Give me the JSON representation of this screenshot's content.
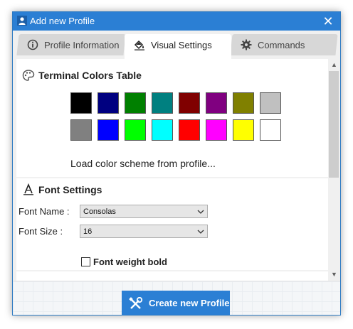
{
  "window": {
    "title": "Add new Profile",
    "close_glyph": "✕"
  },
  "tabs": [
    {
      "label": "Profile Information",
      "icon": "info-icon"
    },
    {
      "label": "Visual Settings",
      "icon": "paint-bucket-icon",
      "active": true
    },
    {
      "label": "Commands",
      "icon": "gear-icon"
    }
  ],
  "colors_section": {
    "title": "Terminal Colors Table",
    "icon": "palette-icon",
    "swatches_row1": [
      "#000000",
      "#000080",
      "#008000",
      "#008080",
      "#800000",
      "#800080",
      "#808000",
      "#c0c0c0"
    ],
    "swatches_row2": [
      "#808080",
      "#0000ff",
      "#00ff00",
      "#00ffff",
      "#ff0000",
      "#ff00ff",
      "#ffff00",
      "#ffffff"
    ],
    "load_link": "Load color scheme from profile..."
  },
  "font_section": {
    "title": "Font Settings",
    "icon": "font-icon",
    "font_name_label": "Font Name :",
    "font_name_value": "Consolas",
    "font_size_label": "Font Size :",
    "font_size_value": "16",
    "bold_label": "Font weight bold",
    "bold_checked": false
  },
  "footer": {
    "create_button": "Create new Profile",
    "create_icon": "tools-icon"
  },
  "theme": {
    "accent": "#2b7fd4",
    "tab_inactive": "#d7d7d7"
  }
}
